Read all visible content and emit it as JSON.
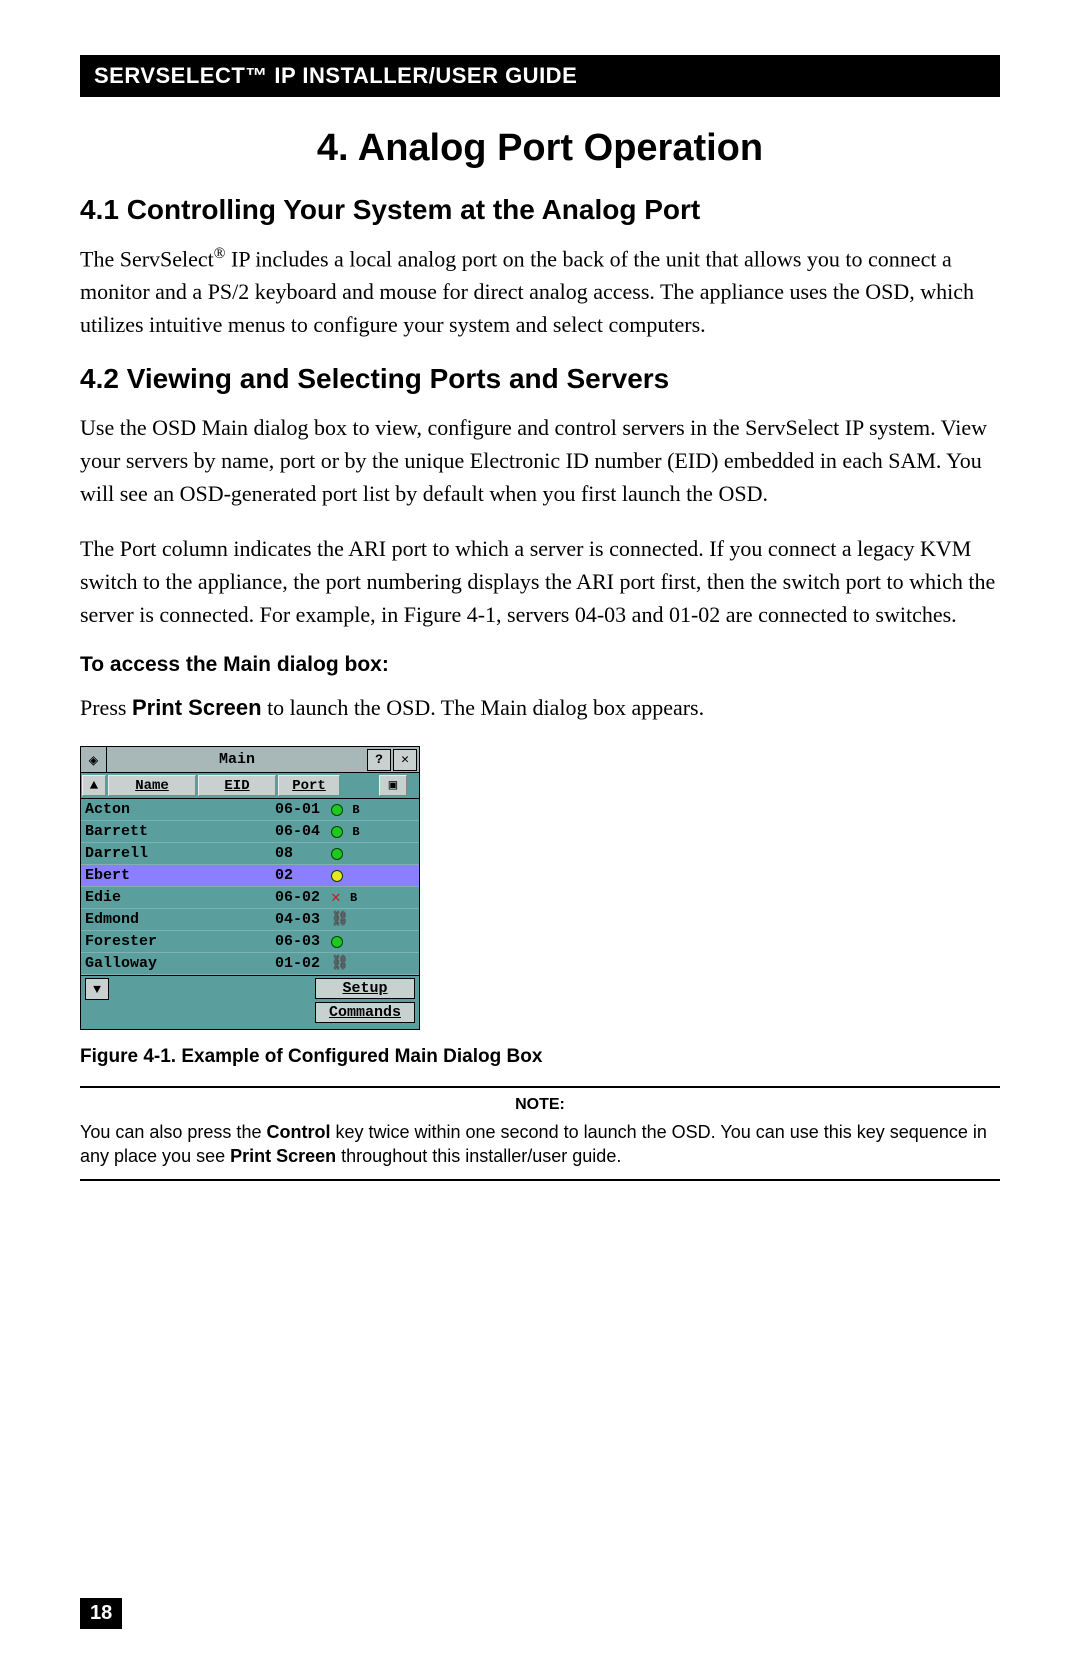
{
  "header": "SERVSELECT™ IP INSTALLER/USER GUIDE",
  "chapter_title": "4. Analog Port Operation",
  "section41_title": "4.1 Controlling Your System at the Analog Port",
  "section41_p_a": "The ServSelect",
  "section41_sup": "®",
  "section41_p_b": " IP includes a local analog port on the back of the unit that allows you to connect a monitor and a PS/2 keyboard and mouse for direct analog access. The appliance uses the OSD, which utilizes intuitive menus to configure your system and select computers.",
  "section42_title": "4.2 Viewing and Selecting Ports and Servers",
  "section42_p1": "Use the OSD Main dialog box to view, configure and control servers in the ServSelect IP system. View your servers by name, port or by the unique Electronic ID number (EID) embedded in each SAM. You will see an OSD-generated port list by default when you first launch the OSD.",
  "section42_p2": "The Port column indicates the ARI port to which a server is connected. If you connect a legacy KVM switch to the appliance, the port numbering displays the ARI port first, then the switch port to which the server is connected. For example, in Figure 4-1, servers 04-03 and 01-02 are connected to switches.",
  "access_heading": "To access the Main dialog box:",
  "access_p_a": "Press ",
  "access_bold": "Print Screen",
  "access_p_b": " to launch the OSD. The Main dialog box appears.",
  "figure_caption": "Figure 4-1. Example of Configured Main Dialog Box",
  "note_title": "NOTE:",
  "note_a": "You can also press the ",
  "note_bold1": "Control",
  "note_b": " key twice within one second to launch the OSD. You can use this key sequence in any place you see ",
  "note_bold2": "Print Screen",
  "note_c": " throughout this installer/user guide.",
  "page_number": "18",
  "osd": {
    "title": "Main",
    "help": "?",
    "close": "✕",
    "up": "▲",
    "down": "▼",
    "col_name": "Name",
    "col_eid": "EID",
    "col_port": "Port",
    "col_stat": "▣",
    "setup": "Setup",
    "commands": "Commands",
    "rows": [
      {
        "name": "Acton",
        "port": "06-01",
        "icon": "green",
        "flag": "B"
      },
      {
        "name": "Barrett",
        "port": "06-04",
        "icon": "green",
        "flag": "B"
      },
      {
        "name": "Darrell",
        "port": "08",
        "icon": "green",
        "flag": ""
      },
      {
        "name": "Ebert",
        "port": "02",
        "icon": "yellow",
        "flag": "",
        "sel": true
      },
      {
        "name": "Edie",
        "port": "06-02",
        "icon": "xred",
        "flag": "B"
      },
      {
        "name": "Edmond",
        "port": "04-03",
        "icon": "chain",
        "flag": ""
      },
      {
        "name": "Forester",
        "port": "06-03",
        "icon": "green",
        "flag": ""
      },
      {
        "name": "Galloway",
        "port": "01-02",
        "icon": "chain",
        "flag": ""
      }
    ]
  }
}
